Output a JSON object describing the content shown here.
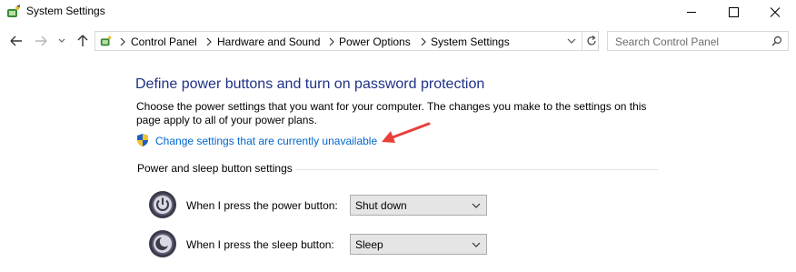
{
  "window": {
    "title": "System Settings",
    "icon": "control-panel-power-icon",
    "controls": [
      "minimize-icon",
      "maximize-icon",
      "close-icon"
    ]
  },
  "navigation": {
    "buttons": [
      "back-arrow-icon",
      "forward-arrow-icon",
      "recent-dropdown-icon",
      "up-arrow-icon"
    ],
    "breadcrumb": [
      "Control Panel",
      "Hardware and Sound",
      "Power Options",
      "System Settings"
    ],
    "search_placeholder": "Search Control Panel"
  },
  "main": {
    "heading": "Define power buttons and turn on password protection",
    "description": "Choose the power settings that you want for your computer. The changes you make to the settings on this page apply to all of your power plans.",
    "admin_link": "Change settings that are currently unavailable",
    "annotation_arrow_color": "#e8403a",
    "section_title": "Power and sleep button settings",
    "rows": [
      {
        "label": "When I press the power button:",
        "value": "Shut down",
        "icon": "power-button-icon"
      },
      {
        "label": "When I press the sleep button:",
        "value": "Sleep",
        "icon": "sleep-button-icon"
      }
    ]
  }
}
